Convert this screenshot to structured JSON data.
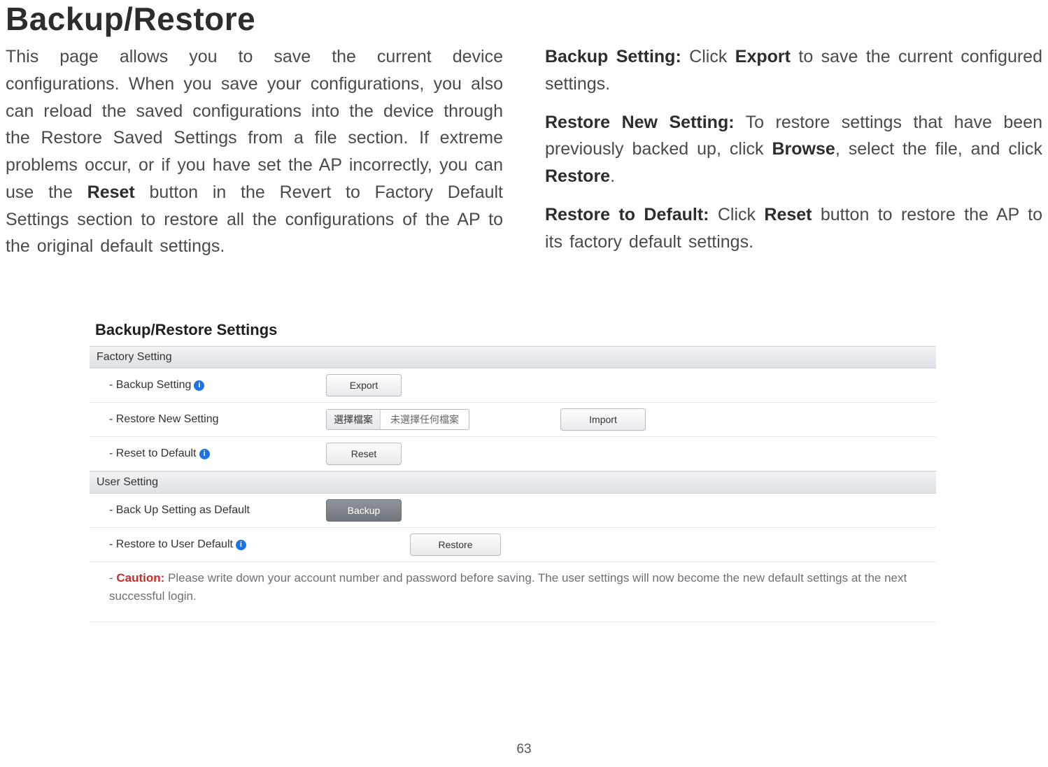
{
  "title": "Backup/Restore",
  "left_para": "This page allows you to save the current device configurations. When you save your configurations, you also can reload the saved configurations into the device through the Restore Saved Settings from a file section. If extreme problems occur, or if you have set the AP incorrectly, you can use the ",
  "left_reset": "Reset",
  "left_para_tail": " button in the Revert to Factory Default Settings section to restore all the configurations of the AP to the original default settings.",
  "right": {
    "p1_a": "Backup Setting:",
    "p1_b": " Click ",
    "p1_c": "Export",
    "p1_d": " to save the current configured settings.",
    "p2_a": "Restore New Setting:",
    "p2_b": " To restore settings that have been previously backed up, click ",
    "p2_c": "Browse",
    "p2_d": ", select the file, and click ",
    "p2_e": "Restore",
    "p2_f": ".",
    "p3_a": "Restore to Default:",
    "p3_b": " Click ",
    "p3_c": "Reset",
    "p3_d": " button to restore the AP to its factory default settings."
  },
  "panel": {
    "title": "Backup/Restore Settings",
    "section_factory": "Factory Setting",
    "section_user": "User Setting",
    "rows": {
      "backup_setting": "- Backup Setting",
      "restore_new": "- Restore New Setting",
      "reset_default": "- Reset to Default",
      "backup_as_default": "- Back Up Setting as Default",
      "restore_user_default": "- Restore to User Default"
    },
    "file": {
      "choose": "選擇檔案",
      "nofile": "未選擇任何檔案"
    },
    "buttons": {
      "export": "Export",
      "import": "Import",
      "reset": "Reset",
      "backup": "Backup",
      "restore": "Restore"
    },
    "caution_label": "Caution:",
    "caution_dash": "- ",
    "caution_text": " Please write down your account number and password before saving. The user settings will now become the new default settings at the next successful login."
  },
  "info_glyph": "i",
  "page_number": "63"
}
